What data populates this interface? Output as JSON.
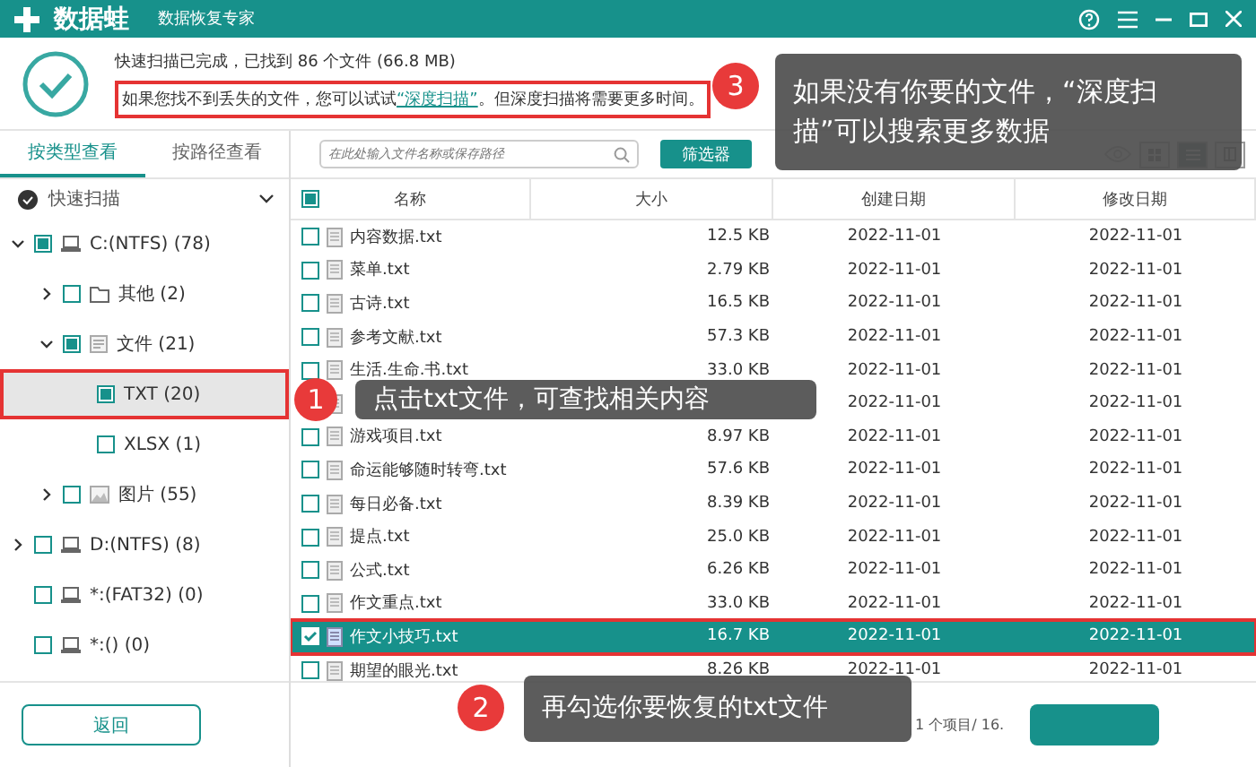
{
  "app": {
    "name": "数据蛙",
    "subtitle": "数据恢复专家"
  },
  "scan_summary": {
    "status": "快速扫描已完成，已找到 86 个文件 (66.8 MB)",
    "hint_before": "如果您找不到丢失的文件，您可以试试",
    "hint_link": "“深度扫描”",
    "hint_after": "。但深度扫描将需要更多时间。",
    "highlighted": true
  },
  "sidebar": {
    "tabs": [
      {
        "label": "按类型查看",
        "selected": true
      },
      {
        "label": "按路径查看",
        "selected": false
      }
    ],
    "scan_label": "快速扫描",
    "tree": [
      {
        "label": "C:(NTFS) (78)",
        "kind": "drive",
        "checked": true,
        "partial": true,
        "expanded": true,
        "selected": false,
        "children": [
          {
            "label": "其他 (2)",
            "kind": "folder",
            "checked": false,
            "expanded": false,
            "selected": false
          },
          {
            "label": "文件 (21)",
            "kind": "document",
            "checked": true,
            "partial": true,
            "expanded": true,
            "selected": false,
            "children": [
              {
                "label": "TXT (20)",
                "kind": "type",
                "checked": true,
                "partial": true,
                "selected": true
              },
              {
                "label": "XLSX (1)",
                "kind": "type",
                "checked": false,
                "selected": false
              }
            ]
          },
          {
            "label": "图片 (55)",
            "kind": "image",
            "checked": false,
            "expanded": false,
            "selected": false
          }
        ]
      },
      {
        "label": "D:(NTFS) (8)",
        "kind": "drive",
        "checked": false,
        "expanded": false,
        "selected": false
      },
      {
        "label": "*:(FAT32) (0)",
        "kind": "drive",
        "checked": false,
        "selected": false
      },
      {
        "label": "*:() (0)",
        "kind": "drive",
        "checked": false,
        "selected": false
      }
    ],
    "back_button": "返回"
  },
  "search": {
    "placeholder": "在此处输入文件名称或保存路径"
  },
  "filter_button": "筛选器",
  "table": {
    "columns": [
      "名称",
      "大小",
      "创建日期",
      "修改日期"
    ],
    "header_checked": true,
    "header_partial": true,
    "rows": [
      {
        "name": "内容数据.txt",
        "size": "12.5 KB",
        "created": "2022-11-01",
        "modified": "2022-11-01",
        "checked": false,
        "selected": false
      },
      {
        "name": "菜单.txt",
        "size": "2.79 KB",
        "created": "2022-11-01",
        "modified": "2022-11-01",
        "checked": false,
        "selected": false
      },
      {
        "name": "古诗.txt",
        "size": "16.5 KB",
        "created": "2022-11-01",
        "modified": "2022-11-01",
        "checked": false,
        "selected": false
      },
      {
        "name": "参考文献.txt",
        "size": "57.3 KB",
        "created": "2022-11-01",
        "modified": "2022-11-01",
        "checked": false,
        "selected": false
      },
      {
        "name": "生活.生命.书.txt",
        "size": "33.0 KB",
        "created": "2022-11-01",
        "modified": "2022-11-01",
        "checked": false,
        "selected": false
      },
      {
        "created": "2022-11-01",
        "modified": "2022-11-01",
        "selected": false
      },
      {
        "name": "游戏项目.txt",
        "size": "8.97 KB",
        "created": "2022-11-01",
        "modified": "2022-11-01",
        "checked": false,
        "selected": false
      },
      {
        "name": "命运能够随时转弯.txt",
        "size": "57.6 KB",
        "created": "2022-11-01",
        "modified": "2022-11-01",
        "checked": false,
        "selected": false
      },
      {
        "name": "每日必备.txt",
        "size": "8.39 KB",
        "created": "2022-11-01",
        "modified": "2022-11-01",
        "checked": false,
        "selected": false
      },
      {
        "name": "提点.txt",
        "size": "25.0 KB",
        "created": "2022-11-01",
        "modified": "2022-11-01",
        "checked": false,
        "selected": false
      },
      {
        "name": "公式.txt",
        "size": "6.26 KB",
        "created": "2022-11-01",
        "modified": "2022-11-01",
        "checked": false,
        "selected": false
      },
      {
        "name": "作文重点.txt",
        "size": "33.0 KB",
        "created": "2022-11-01",
        "modified": "2022-11-01",
        "checked": false,
        "selected": false
      },
      {
        "name": "作文小技巧.txt",
        "size": "16.7 KB",
        "created": "2022-11-01",
        "modified": "2022-11-01",
        "checked": true,
        "selected": true
      },
      {
        "name": "期望的眼光.txt",
        "size": "8.26 KB",
        "created": "2022-11-01",
        "modified": "2022-11-01",
        "checked": false,
        "selected": false
      }
    ]
  },
  "status_bar": {
    "selection": "1 个项目/ 16."
  },
  "callouts": [
    {
      "number": "1",
      "text": "点击txt文件，可查找相关内容"
    },
    {
      "number": "2",
      "text": "再勾选你要恢复的txt文件"
    },
    {
      "number": "3",
      "text": "如果没有你要的文件，“深度扫描”可以搜索更多数据"
    }
  ]
}
